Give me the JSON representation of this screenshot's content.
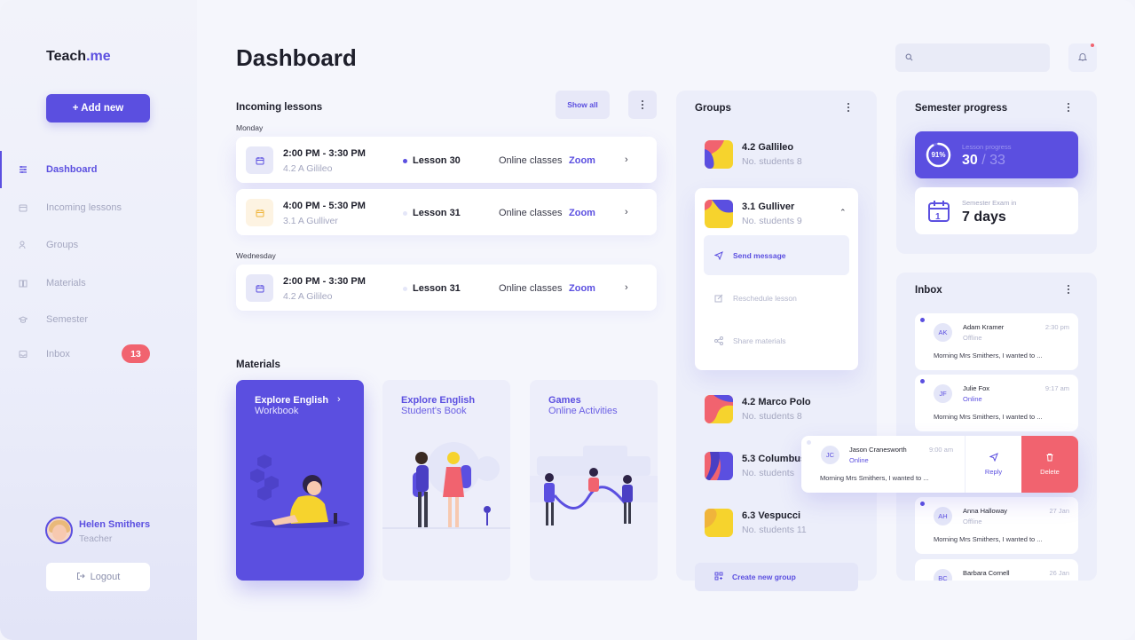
{
  "app": {
    "logo_main": "Teach",
    "logo_accent": ".me",
    "add_new_label": "+ Add new",
    "page_title": "Dashboard",
    "search_placeholder": ""
  },
  "nav": {
    "items": [
      {
        "label": "Dashboard",
        "icon": "sliders-icon",
        "active": true
      },
      {
        "label": "Incoming lessons",
        "icon": "calendar-icon",
        "active": false
      },
      {
        "label": "Groups",
        "icon": "users-icon",
        "active": false
      },
      {
        "label": "Materials",
        "icon": "book-icon",
        "active": false
      },
      {
        "label": "Semester",
        "icon": "graduation-cap-icon",
        "active": false
      },
      {
        "label": "Inbox",
        "icon": "inbox-icon",
        "active": false,
        "badge": "13"
      }
    ]
  },
  "profile": {
    "name": "Helen Smithers",
    "role": "Teacher"
  },
  "logout_label": "Logout",
  "lessons": {
    "title": "Incoming lessons",
    "show_all_label": "Show all",
    "days": [
      {
        "label": "Monday",
        "items": [
          {
            "time": "2:00 PM - 3:30 PM",
            "group": "4.2 A Gilileo",
            "lesson": "Lesson 30",
            "type": "Online classes",
            "link": "Zoom",
            "icon_color": "#5b4fe0",
            "icon_bg": "#e7e8f8",
            "dot_color": "#5b4fe0"
          },
          {
            "time": "4:00 PM - 5:30 PM",
            "group": "3.1 A Gulliver",
            "lesson": "Lesson 31",
            "type": "Online classes",
            "link": "Zoom",
            "icon_color": "#f0b43b",
            "icon_bg": "#fdf3e2",
            "dot_color": "#e4e6f8"
          }
        ]
      },
      {
        "label": "Wednesday",
        "items": [
          {
            "time": "2:00 PM - 3:30 PM",
            "group": "4.2 A Gilileo",
            "lesson": "Lesson 31",
            "type": "Online classes",
            "link": "Zoom",
            "icon_color": "#5b4fe0",
            "icon_bg": "#e7e8f8",
            "dot_color": "#e4e6f8"
          }
        ]
      }
    ]
  },
  "materials": {
    "title": "Materials",
    "cards": [
      {
        "title": "Explore English",
        "subtitle": "Workbook",
        "chevron": "›"
      },
      {
        "title": "Explore English",
        "subtitle": "Student's Book"
      },
      {
        "title": "Games",
        "subtitle": "Online Activities"
      }
    ]
  },
  "groups": {
    "title": "Groups",
    "items": [
      {
        "name": "4.2 Gallileo",
        "students": "No. students 8"
      },
      {
        "name": "3.1 Gulliver",
        "students": "No. students 9"
      },
      {
        "name": "4.2 Marco Polo",
        "students": "No. students 8"
      },
      {
        "name": "5.3 Columbus",
        "students": "No. students"
      },
      {
        "name": "6.3 Vespucci",
        "students": "No. students  11"
      }
    ],
    "actions": [
      {
        "label": "Send message",
        "icon": "send-icon"
      },
      {
        "label": "Reschedule lesson",
        "icon": "edit-icon"
      },
      {
        "label": "Share materials",
        "icon": "share-icon"
      }
    ],
    "create_label": "Create new group"
  },
  "semester": {
    "title": "Semester progress",
    "progress_label": "Lesson progress",
    "progress_pct_label": "91%",
    "progress_fraction": 0.91,
    "progress_done": "30",
    "progress_total": "/ 33",
    "exam_label": "Semester Exam in",
    "exam_value": "7 days",
    "exam_icon_number": "1"
  },
  "inbox": {
    "title": "Inbox",
    "messages": [
      {
        "initials": "AK",
        "name": "Adam Kramer",
        "status": "Offline",
        "time": "2:30 pm",
        "text": "Morning Mrs Smithers, I wanted to ...",
        "online": false
      },
      {
        "initials": "JF",
        "name": "Julie Fox",
        "status": "Online",
        "time": "9:17 am",
        "text": "Morning Mrs Smithers, I wanted to ...",
        "online": true
      },
      {
        "initials": "JC",
        "name": "Jason Cranesworth",
        "status": "Online",
        "time": "9:00 am",
        "text": "Morning Mrs Smithers, I wanted to ...",
        "online": true
      },
      {
        "initials": "AH",
        "name": "Anna Halloway",
        "status": "Offline",
        "time": "27 Jan",
        "text": "Morning Mrs Smithers, I wanted to ...",
        "online": false
      },
      {
        "initials": "BC",
        "name": "Barbara Cornell",
        "status": "",
        "time": "26 Jan",
        "text": "",
        "online": false
      }
    ],
    "reply_label": "Reply",
    "delete_label": "Delete"
  },
  "colors": {
    "accent": "#5b4fe0",
    "danger": "#f1636f",
    "warning": "#f0b43b"
  }
}
